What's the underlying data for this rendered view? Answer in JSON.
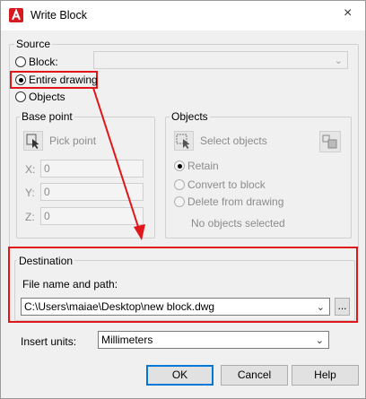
{
  "window": {
    "title": "Write Block",
    "close_glyph": "×"
  },
  "source": {
    "label": "Source",
    "options": [
      {
        "label": "Block:",
        "selected": false
      },
      {
        "label": "Entire drawing",
        "selected": true
      },
      {
        "label": "Objects",
        "selected": false
      }
    ],
    "block_dropdown_value": ""
  },
  "base_point": {
    "label": "Base point",
    "pick_point_label": "Pick point",
    "x_label": "X:",
    "x_value": "0",
    "y_label": "Y:",
    "y_value": "0",
    "z_label": "Z:",
    "z_value": "0"
  },
  "objects": {
    "label": "Objects",
    "select_objects_label": "Select objects",
    "options": [
      {
        "label": "Retain",
        "selected": true
      },
      {
        "label": "Convert to block",
        "selected": false
      },
      {
        "label": "Delete from drawing",
        "selected": false
      }
    ],
    "status": "No objects selected"
  },
  "destination": {
    "label": "Destination",
    "file_label": "File name and path:",
    "file_value": "C:\\Users\\maiae\\Desktop\\new block.dwg",
    "browse_label": "..."
  },
  "insert_units": {
    "label": "Insert units:",
    "value": "Millimeters"
  },
  "buttons": {
    "ok": "OK",
    "cancel": "Cancel",
    "help": "Help"
  },
  "annotation_color": "#e0161b",
  "accent_color": "#0078d7"
}
